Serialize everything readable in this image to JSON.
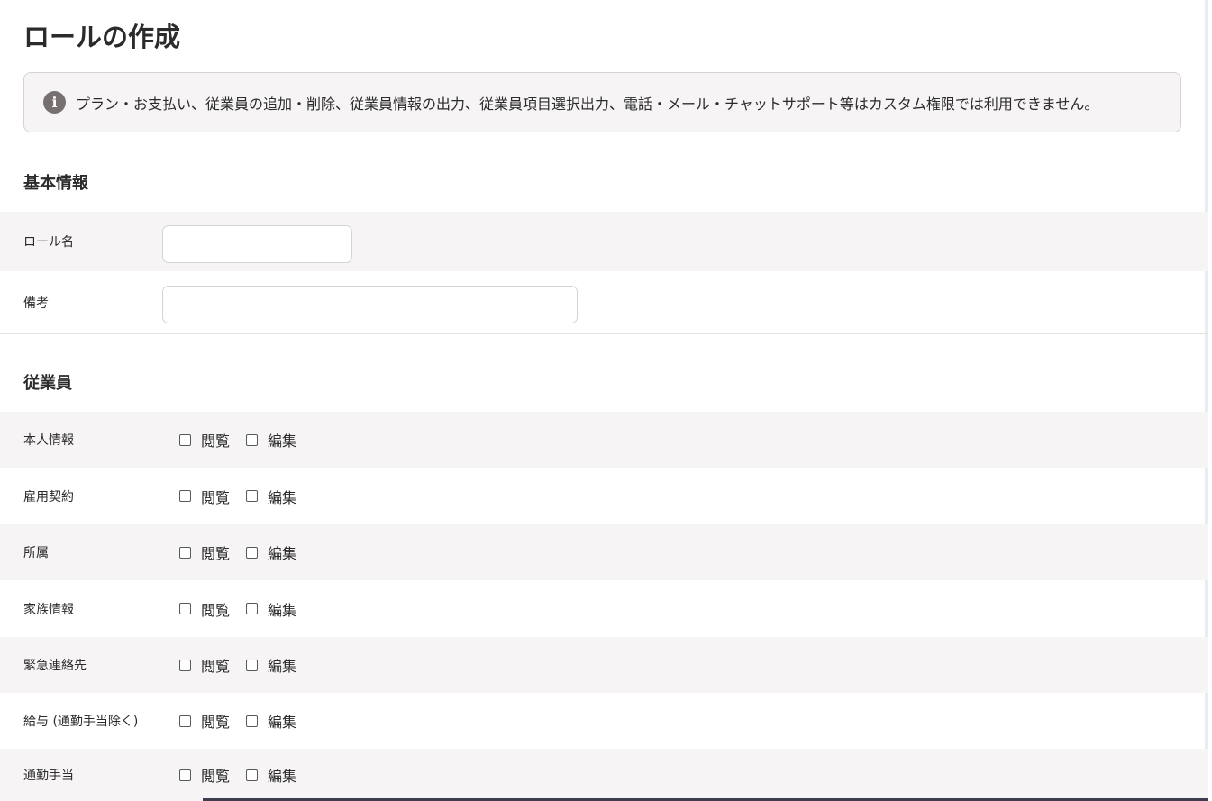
{
  "page": {
    "title": "ロールの作成"
  },
  "notice": {
    "icon": "info-icon",
    "text": "プラン・お支払い、従業員の追加・削除、従業員情報の出力、従業員項目選択出力、電話・メール・チャットサポート等はカスタム権限では利用できません。"
  },
  "basic_info": {
    "heading": "基本情報",
    "role_name_label": "ロール名",
    "role_name_value": "",
    "note_label": "備考",
    "note_value": ""
  },
  "employee": {
    "heading": "従業員",
    "view_label": "閲覧",
    "edit_label": "編集",
    "rows": [
      {
        "label": "本人情報",
        "view": false,
        "edit": false
      },
      {
        "label": "雇用契約",
        "view": false,
        "edit": false
      },
      {
        "label": "所属",
        "view": false,
        "edit": false
      },
      {
        "label": "家族情報",
        "view": false,
        "edit": false
      },
      {
        "label": "緊急連絡先",
        "view": false,
        "edit": false
      },
      {
        "label": "給与 (通勤手当除く)",
        "view": false,
        "edit": false
      },
      {
        "label": "通勤手当",
        "view": false,
        "edit": false
      }
    ]
  },
  "colors": {
    "text": "#2b2b2b",
    "row_shade": "#f6f4f4",
    "border": "#d6d3d3",
    "info_icon": "#767170"
  }
}
